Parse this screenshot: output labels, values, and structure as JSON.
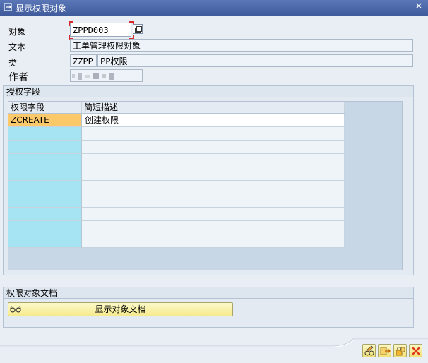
{
  "window": {
    "title": "显示权限对象"
  },
  "form": {
    "object_label": "对象",
    "object_value": "ZPPD003",
    "text_label": "文本",
    "text_value": "工单管理权限对象",
    "class_label": "类",
    "class_code": "ZZPP",
    "class_name": "PP权限",
    "author_label": "作者"
  },
  "auth_fields": {
    "group_title": "授权字段",
    "columns": [
      "权限字段",
      "简短描述"
    ],
    "rows": [
      {
        "field": "ZCREATE",
        "description": "创建权限"
      }
    ]
  },
  "documentation": {
    "group_title": "权限对象文档",
    "button_label": "显示对象文档"
  },
  "icons": {
    "window": "window-icon",
    "close": "close-icon",
    "copy": "copy-icon",
    "glasses": "glasses-icon",
    "footer": [
      "edit-pencil-icon",
      "transport-icon",
      "lock-icon",
      "cancel-x-icon"
    ]
  },
  "colors": {
    "title_bar": "#4a67aa",
    "selected_field": "#fcc96a",
    "key_column": "#a7e4f3",
    "cancel": "#e03a1a"
  }
}
